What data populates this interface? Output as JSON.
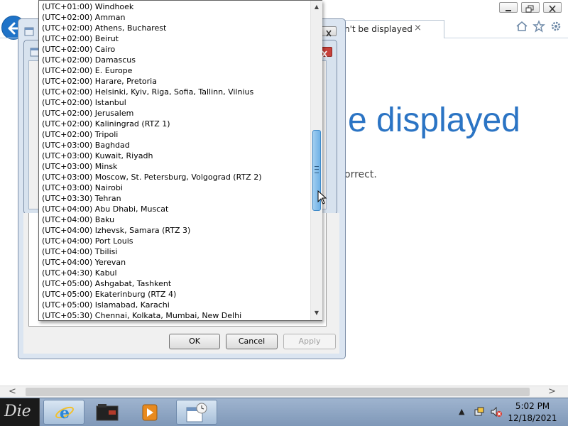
{
  "browser": {
    "tab_title": "n't be displayed",
    "tab_close": "×",
    "heading": "e displayed",
    "subtext": "orrect.",
    "window_controls": [
      "minimize-icon",
      "restore-icon",
      "close-icon"
    ],
    "toolbar_icons": [
      "home-icon",
      "star-icon",
      "gear-icon"
    ],
    "scroll_left": "<",
    "scroll_right": ">"
  },
  "dialog": {
    "buttons": {
      "ok": "OK",
      "cancel": "Cancel",
      "apply": "Apply"
    },
    "close_icon": "close-icon"
  },
  "timezone_list": {
    "items": [
      "(UTC+01:00) Windhoek",
      "(UTC+02:00) Amman",
      "(UTC+02:00) Athens, Bucharest",
      "(UTC+02:00) Beirut",
      "(UTC+02:00) Cairo",
      "(UTC+02:00) Damascus",
      "(UTC+02:00) E. Europe",
      "(UTC+02:00) Harare, Pretoria",
      "(UTC+02:00) Helsinki, Kyiv, Riga, Sofia, Tallinn, Vilnius",
      "(UTC+02:00) Istanbul",
      "(UTC+02:00) Jerusalem",
      "(UTC+02:00) Kaliningrad (RTZ 1)",
      "(UTC+02:00) Tripoli",
      "(UTC+03:00) Baghdad",
      "(UTC+03:00) Kuwait, Riyadh",
      "(UTC+03:00) Minsk",
      "(UTC+03:00) Moscow, St. Petersburg, Volgograd (RTZ 2)",
      "(UTC+03:00) Nairobi",
      "(UTC+03:30) Tehran",
      "(UTC+04:00) Abu Dhabi, Muscat",
      "(UTC+04:00) Baku",
      "(UTC+04:00) Izhevsk, Samara (RTZ 3)",
      "(UTC+04:00) Port Louis",
      "(UTC+04:00) Tbilisi",
      "(UTC+04:00) Yerevan",
      "(UTC+04:30) Kabul",
      "(UTC+05:00) Ashgabat, Tashkent",
      "(UTC+05:00) Ekaterinburg (RTZ 4)",
      "(UTC+05:00) Islamabad, Karachi",
      "(UTC+05:30) Chennai, Kolkata, Mumbai, New Delhi"
    ],
    "scroll_up": "▲",
    "scroll_down": "▼"
  },
  "taskbar": {
    "start_label": "Die",
    "apps": [
      "internet-explorer-icon",
      "folder-icon",
      "media-player-icon",
      "date-time-icon"
    ],
    "clock_time": "5:02 PM",
    "clock_date": "12/18/2021",
    "tray_icons": [
      "show-hidden-icons-icon",
      "network-icon",
      "volume-muted-icon"
    ]
  },
  "colors": {
    "accent_blue": "#2b74c4",
    "scroll_thumb": "#6fb1e6",
    "close_red": "#c7413b"
  }
}
